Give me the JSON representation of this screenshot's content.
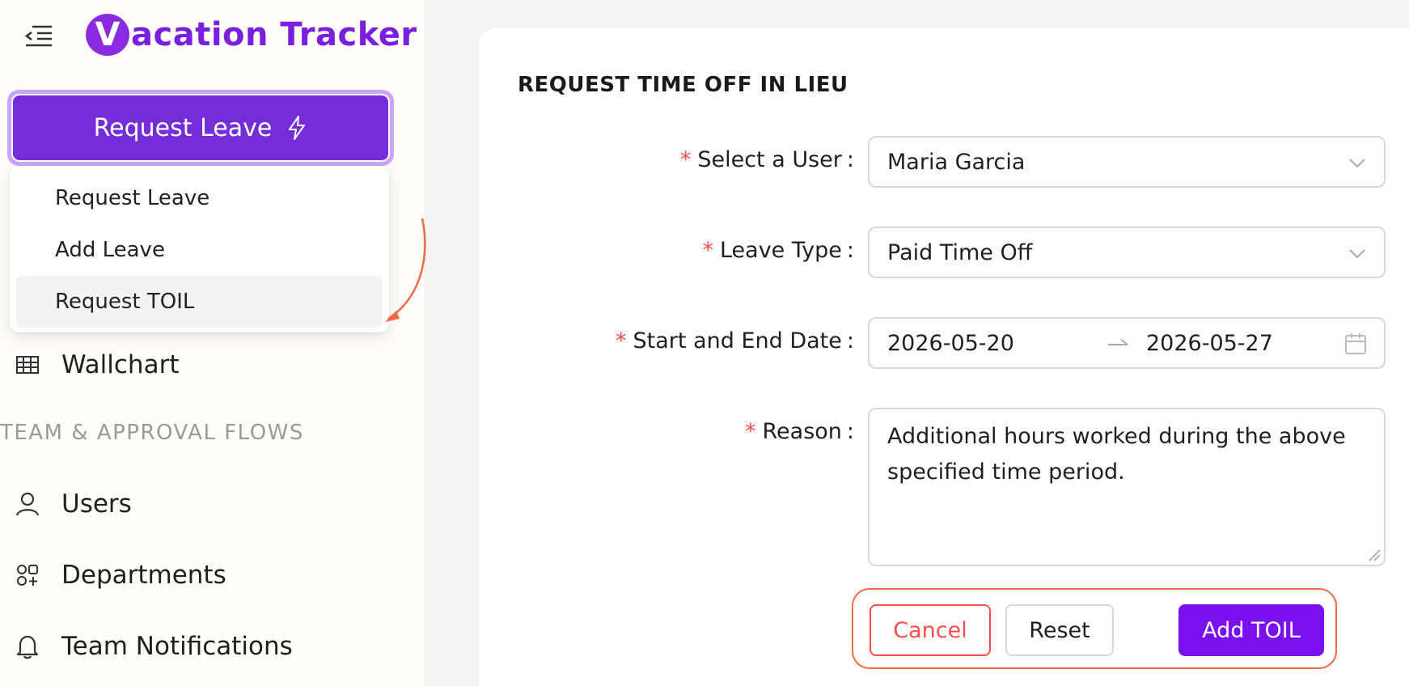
{
  "app": {
    "logo_letter": "V",
    "logo_text": "acation Tracker"
  },
  "sidebar": {
    "request_button_label": "Request Leave",
    "dropdown": [
      {
        "label": "Request Leave"
      },
      {
        "label": "Add Leave"
      },
      {
        "label": "Request TOIL",
        "active": true
      }
    ],
    "wallchart_label": "Wallchart",
    "section_label": "TEAM & APPROVAL FLOWS",
    "users_label": "Users",
    "departments_label": "Departments",
    "team_notifications_label": "Team Notifications"
  },
  "form": {
    "title": "REQUEST TIME OFF IN LIEU",
    "user_label": "Select a User",
    "user_value": "Maria Garcia",
    "leave_type_label": "Leave Type",
    "leave_type_value": "Paid Time Off",
    "dates_label": "Start and End Date",
    "start_date": "2026-05-20",
    "end_date": "2026-05-27",
    "reason_label": "Reason",
    "reason_value": "Additional hours worked during the above specified time period.",
    "required_mark": "*",
    "colon": ":"
  },
  "buttons": {
    "cancel": "Cancel",
    "reset": "Reset",
    "add": "Add TOIL"
  },
  "colors": {
    "brand": "#7a1fe0",
    "request_button": "#732dd9",
    "primary_button": "#7a10f0",
    "danger": "#ff4d4f",
    "annotation": "#ed6a43"
  }
}
